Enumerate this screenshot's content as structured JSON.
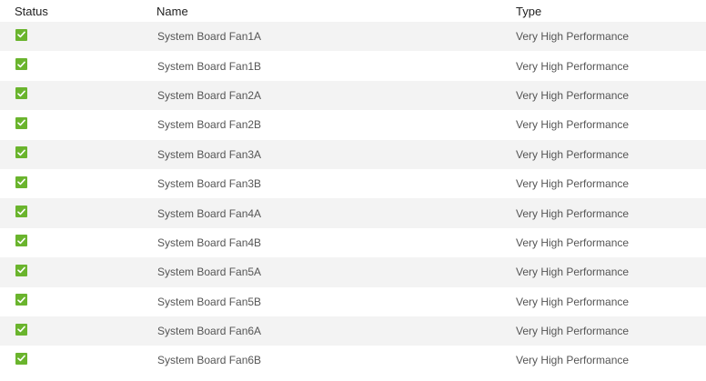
{
  "table": {
    "headers": {
      "status": "Status",
      "name": "Name",
      "type": "Type"
    },
    "rows": [
      {
        "status": "ok",
        "name": "System Board Fan1A",
        "type": "Very High Performance"
      },
      {
        "status": "ok",
        "name": "System Board Fan1B",
        "type": "Very High Performance"
      },
      {
        "status": "ok",
        "name": "System Board Fan2A",
        "type": "Very High Performance"
      },
      {
        "status": "ok",
        "name": "System Board Fan2B",
        "type": "Very High Performance"
      },
      {
        "status": "ok",
        "name": "System Board Fan3A",
        "type": "Very High Performance"
      },
      {
        "status": "ok",
        "name": "System Board Fan3B",
        "type": "Very High Performance"
      },
      {
        "status": "ok",
        "name": "System Board Fan4A",
        "type": "Very High Performance"
      },
      {
        "status": "ok",
        "name": "System Board Fan4B",
        "type": "Very High Performance"
      },
      {
        "status": "ok",
        "name": "System Board Fan5A",
        "type": "Very High Performance"
      },
      {
        "status": "ok",
        "name": "System Board Fan5B",
        "type": "Very High Performance"
      },
      {
        "status": "ok",
        "name": "System Board Fan6A",
        "type": "Very High Performance"
      },
      {
        "status": "ok",
        "name": "System Board Fan6B",
        "type": "Very High Performance"
      }
    ]
  },
  "icons": {
    "status_ok": "check-icon"
  },
  "colors": {
    "status_ok": "#6ab42d",
    "row_stripe": "#f3f3f3"
  }
}
